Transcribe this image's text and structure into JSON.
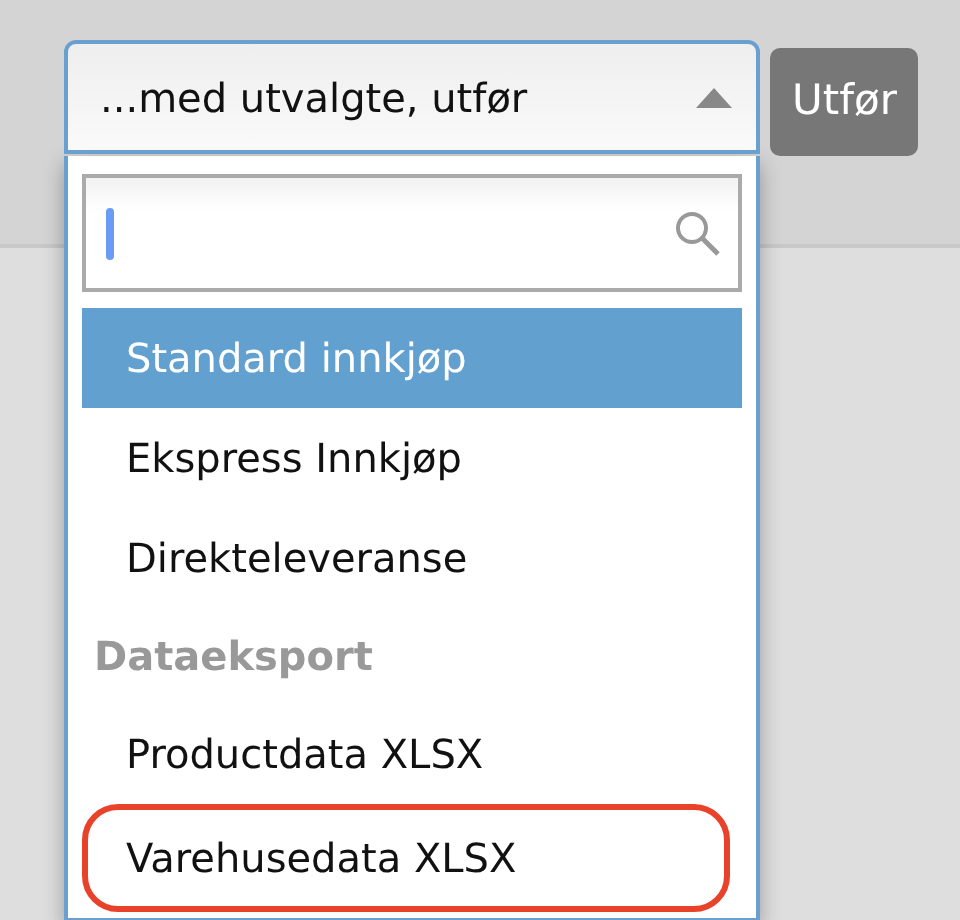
{
  "select": {
    "value": "...med utvalgte, utfør",
    "expanded": true
  },
  "apply_button": {
    "label": "Utfør"
  },
  "options": [
    {
      "kind": "option",
      "label": "Standard innkjøp",
      "selected": true,
      "circled": false
    },
    {
      "kind": "option",
      "label": "Ekspress Innkjøp",
      "selected": false,
      "circled": false
    },
    {
      "kind": "option",
      "label": "Direkteleveranse",
      "selected": false,
      "circled": false
    },
    {
      "kind": "group",
      "label": "Dataeksport"
    },
    {
      "kind": "option",
      "label": "Productdata XLSX",
      "selected": false,
      "circled": false
    },
    {
      "kind": "option",
      "label": "Varehusedata XLSX",
      "selected": false,
      "circled": true
    }
  ]
}
